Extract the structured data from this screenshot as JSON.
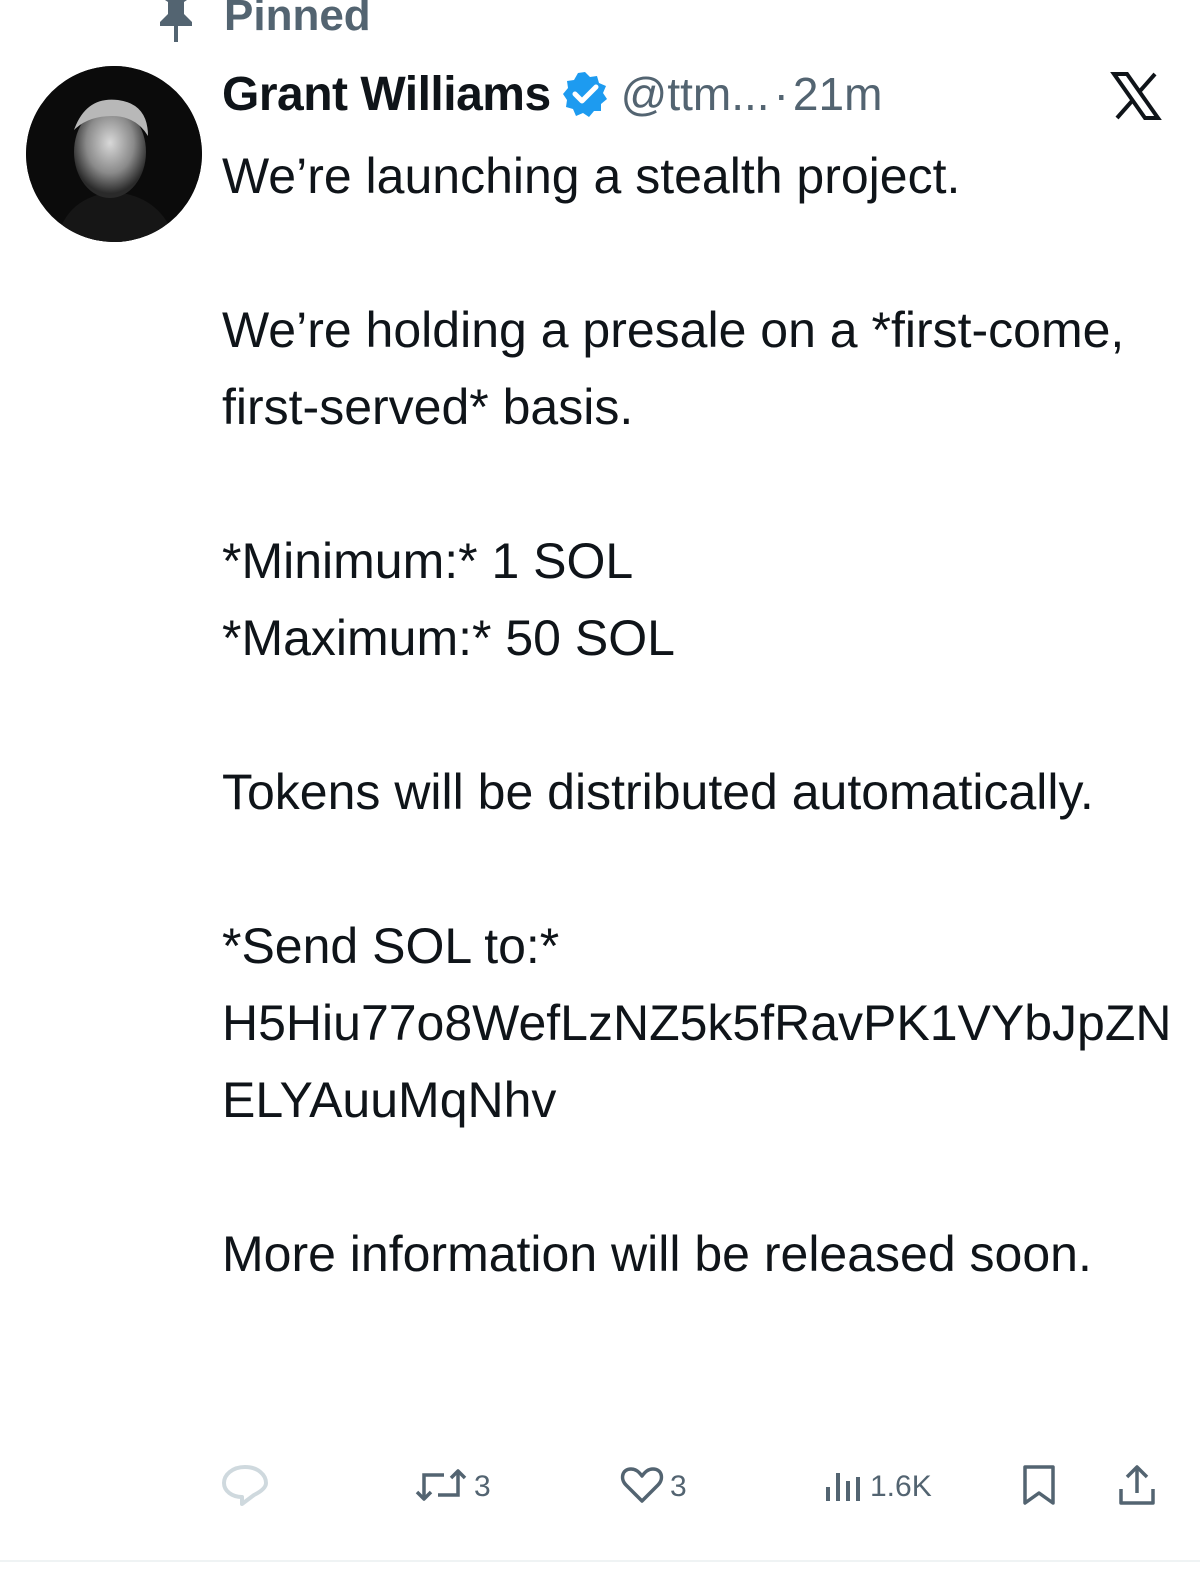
{
  "pinned": {
    "label": "Pinned"
  },
  "author": {
    "name": "Grant Williams",
    "handle": "@ttm...",
    "separator": "·",
    "time": "21m"
  },
  "tweet": {
    "line1": "We’re launching a stealth project.",
    "line2": "We’re holding a presale on a *first-come, first-served* basis.",
    "min": "*Minimum:* 1 SOL",
    "max": "*Maximum:* 50 SOL",
    "tokens": "Tokens will be distributed automatically.",
    "send_label": "*Send SOL to:*",
    "address": "H5Hiu77o8WefLzNZ5k5fRavPK1VYbJpZNELYAuuMqNhv",
    "more": "More information will be released soon."
  },
  "actions": {
    "reposts": "3",
    "likes": "3",
    "views": "1.6K"
  },
  "colors": {
    "text": "#0f1419",
    "muted": "#536471",
    "verified": "#1d9bf0",
    "reply_icon": "#cfd9de"
  },
  "icons": {
    "pin": "pin-icon",
    "verified": "verified-badge-icon",
    "x_logo": "x-logo-icon",
    "reply": "reply-icon",
    "repost": "repost-icon",
    "like": "heart-icon",
    "views": "views-icon",
    "bookmark": "bookmark-icon",
    "share": "share-icon"
  }
}
